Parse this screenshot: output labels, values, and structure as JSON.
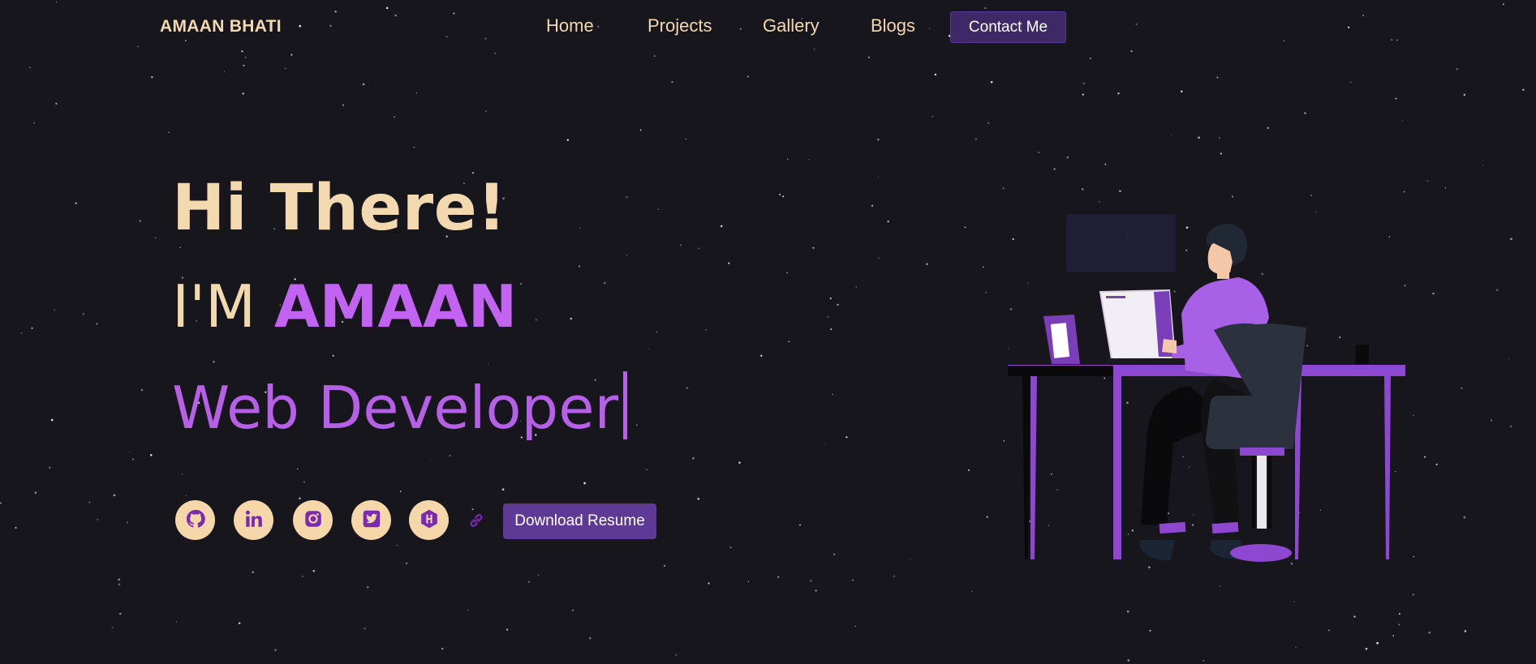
{
  "brand": {
    "name": "AMAAN BHATI"
  },
  "nav": {
    "links": [
      {
        "label": "Home"
      },
      {
        "label": "Projects"
      },
      {
        "label": "Gallery"
      },
      {
        "label": "Blogs"
      }
    ],
    "contact_label": "Contact Me"
  },
  "hero": {
    "greeting": "Hi There!",
    "intro_prefix": "I'M",
    "name": "AMAAN",
    "role": "Web Developer"
  },
  "social": [
    {
      "icon": "github-icon"
    },
    {
      "icon": "linkedin-icon"
    },
    {
      "icon": "instagram-icon"
    },
    {
      "icon": "twitter-icon"
    },
    {
      "icon": "hashnode-icon"
    }
  ],
  "link_icon": "link-icon",
  "resume_button": {
    "label": "Download Resume"
  },
  "illustration": {
    "subject": "developer-at-desk-illustration"
  },
  "colors": {
    "background": "#17161c",
    "cream": "#f3d9b0",
    "accent_purple": "#c264f1",
    "button_purple": "#5e3a96",
    "nav_button": "#3f2866"
  }
}
